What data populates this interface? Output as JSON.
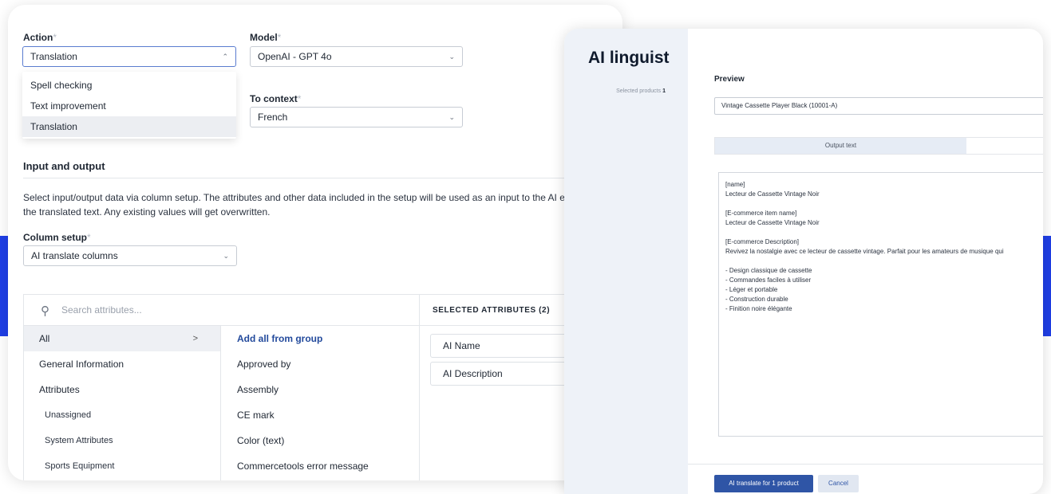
{
  "form": {
    "action": {
      "label": "Action",
      "required_mark": "*",
      "value": "Translation",
      "options": [
        "Spell checking",
        "Text improvement",
        "Translation"
      ]
    },
    "model": {
      "label": "Model",
      "required_mark": "*",
      "value": "OpenAI - GPT 4o"
    },
    "to_context": {
      "label": "To context",
      "required_mark": "*",
      "value": "French"
    },
    "section_title": "Input and output",
    "description_line1": "Select input/output data via column setup. The attributes and other data included in the setup will be used as an input to the AI engine. The",
    "description_line2": "the translated text. Any existing values will get overwritten.",
    "column_setup": {
      "label": "Column setup",
      "required_mark": "*",
      "value": "AI translate columns"
    }
  },
  "attributes": {
    "search_placeholder": "Search attributes...",
    "selected_header": "SELECTED ATTRIBUTES (2)",
    "groups": [
      "All",
      "General Information",
      "Attributes",
      "Unassigned",
      "System Attributes",
      "Sports Equipment"
    ],
    "group_arrow": ">",
    "items": [
      "Add all from group",
      "Approved by",
      "Assembly",
      "CE mark",
      "Color (text)",
      "Commercetools error message"
    ],
    "selected": [
      "AI Name",
      "AI Description"
    ]
  },
  "linguist": {
    "title": "AI linguist",
    "selected_products_label": "Selected products",
    "selected_products_count": "1",
    "preview_label": "Preview",
    "preview_value": "Vintage Cassette Player Black (10001-A)",
    "tab_output": "Output text",
    "output_text": "[name]\nLecteur de Cassette Vintage Noir\n\n[E-commerce item name]\nLecteur de Cassette Vintage Noir\n\n[E-commerce Description]\nRevivez la nostalgie avec ce lecteur de cassette vintage. Parfait pour les amateurs de musique qui\n\n- Design classique de cassette\n- Commandes faciles à utiliser\n- Léger et portable\n- Construction durable\n- Finition noire élégante",
    "primary_button": "AI translate for 1 product",
    "cancel_button": "Cancel"
  },
  "icons": {
    "chevron_down": "⌄",
    "chevron_up": "⌃",
    "search": "⚲"
  },
  "colors": {
    "accent": "#2f55a6",
    "link": "#234a9c",
    "brand_bar": "#1f3fe6"
  }
}
